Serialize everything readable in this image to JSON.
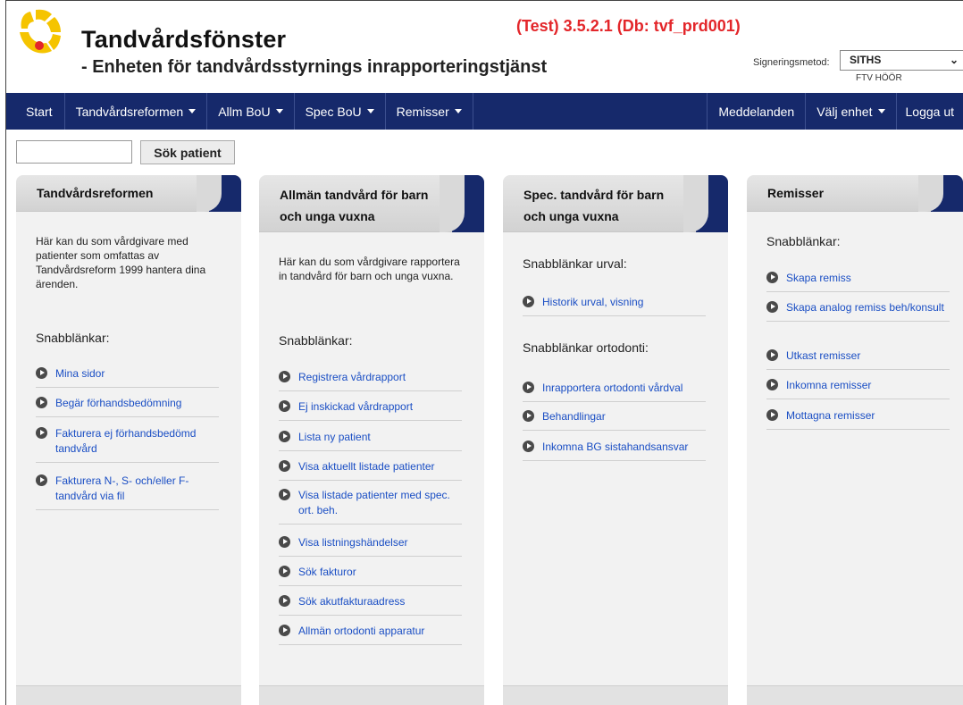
{
  "header": {
    "title": "Tandvårdsfönster",
    "subtitle": "- Enheten för tandvårdsstyrnings inrapporteringstjänst",
    "version": "(Test) 3.5.2.1 (Db: tvf_prd001)",
    "sign_label": "Signeringsmetod:",
    "sign_value": "SITHS",
    "unit": "FTV HÖÖR",
    "accent_color": "#e3262a"
  },
  "nav": {
    "color": "#16296b",
    "start": "Start",
    "tandvardsreformen": "Tandvårdsreformen",
    "allm_bou": "Allm BoU",
    "spec_bou": "Spec BoU",
    "remisser": "Remisser",
    "meddelanden": "Meddelanden",
    "valj_enhet": "Välj enhet",
    "logga_ut": "Logga ut"
  },
  "search": {
    "value": "",
    "button": "Sök patient"
  },
  "panels": {
    "tdr": {
      "title": "Tandvårdsreformen",
      "intro": "Här kan du som vårdgivare med patienter som omfattas av Tandvårdsreform 1999 hantera dina ärenden.",
      "quick": "Snabblänkar:",
      "links": [
        "Mina sidor",
        "Begär förhandsbedömning",
        "Fakturera ej förhandsbedömd tandvård",
        "Fakturera N-, S- och/eller F-tandvård via fil"
      ]
    },
    "allm": {
      "title": "Allmän tandvård för barn och unga vuxna",
      "intro": "Här kan du som vårdgivare rapportera in tandvård för barn och unga vuxna.",
      "quick": "Snabblänkar:",
      "links": [
        "Registrera vårdrapport",
        "Ej inskickad vårdrapport",
        "Lista ny patient",
        "Visa aktuellt listade patienter",
        "Visa listade patienter med spec. ort. beh.",
        "Visa listningshändelser",
        "Sök fakturor",
        "Sök akutfakturaadress",
        "Allmän ortodonti apparatur"
      ]
    },
    "spec": {
      "title": "Spec. tandvård för barn och unga vuxna",
      "quick_urval": "Snabblänkar urval:",
      "links_urval": [
        "Historik urval, visning"
      ],
      "quick_orto": "Snabblänkar ortodonti:",
      "links_orto": [
        "Inrapportera ortodonti vårdval",
        "Behandlingar",
        "Inkomna BG sistahandsansvar"
      ]
    },
    "rem": {
      "title": "Remisser",
      "quick": "Snabblänkar:",
      "links": [
        "Skapa remiss",
        "Skapa analog remiss beh/konsult",
        "Utkast remisser",
        "Inkomna remisser",
        "Mottagna remisser"
      ]
    }
  }
}
